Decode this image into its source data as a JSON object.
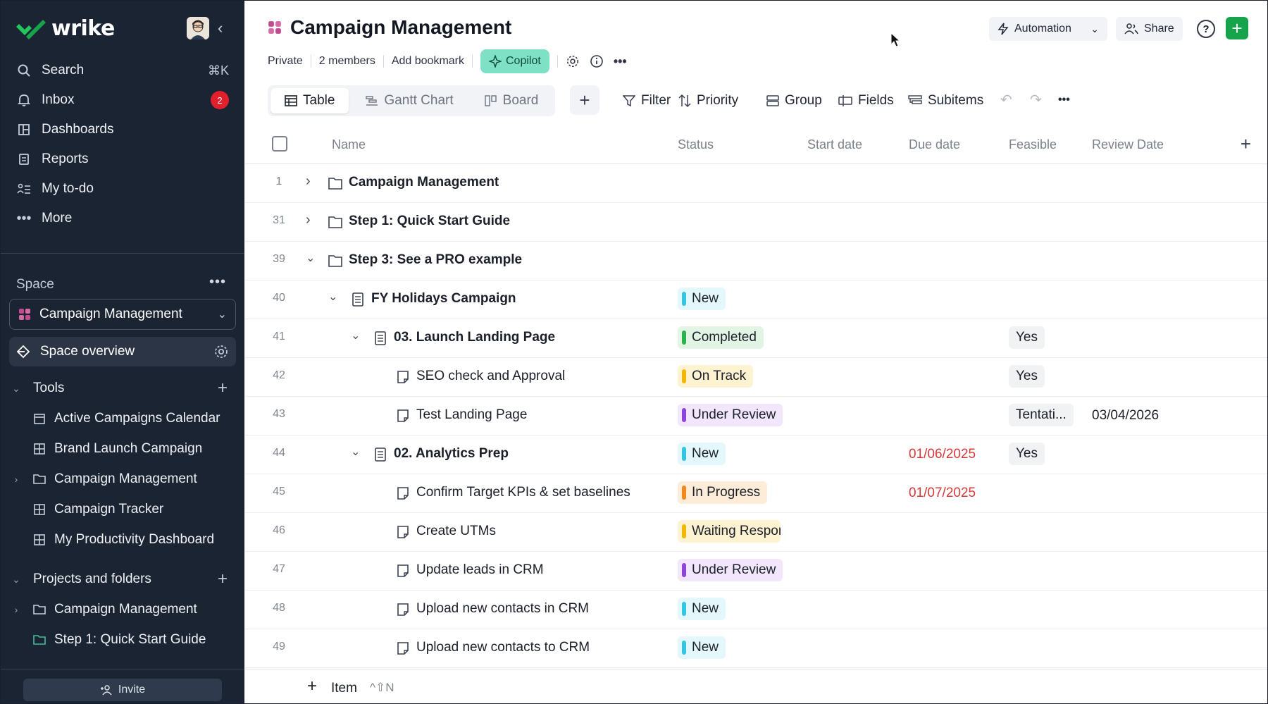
{
  "sidebar": {
    "logo": "wrike",
    "nav": [
      {
        "label": "Search",
        "icon": "search-icon",
        "shortcut": "⌘K"
      },
      {
        "label": "Inbox",
        "icon": "bell-icon",
        "badge": "2"
      },
      {
        "label": "Dashboards",
        "icon": "dashboard-icon"
      },
      {
        "label": "Reports",
        "icon": "report-icon"
      },
      {
        "label": "My to-do",
        "icon": "todo-icon"
      },
      {
        "label": "More",
        "icon": "more-icon"
      }
    ],
    "space_label": "Space",
    "space_selected": "Campaign Management",
    "space_overview": "Space overview",
    "tools_label": "Tools",
    "tools": [
      {
        "label": "Active Campaigns Calendar",
        "icon": "calendar-icon"
      },
      {
        "label": "Brand Launch Campaign",
        "icon": "grid-icon"
      },
      {
        "label": "Campaign Management",
        "icon": "folder-icon"
      },
      {
        "label": "Campaign Tracker",
        "icon": "grid-icon"
      },
      {
        "label": "My Productivity Dashboard",
        "icon": "grid-icon"
      }
    ],
    "projects_label": "Projects and folders",
    "projects": [
      {
        "label": "Campaign Management",
        "icon": "folder-icon"
      },
      {
        "label": "Step 1: Quick Start Guide",
        "icon": "folder-icon"
      }
    ],
    "invite": "Invite"
  },
  "header": {
    "title": "Campaign Management",
    "privacy": "Private",
    "members": "2 members",
    "bookmark": "Add bookmark",
    "copilot": "Copilot",
    "automation": "Automation",
    "share": "Share",
    "help": "?"
  },
  "views": {
    "table": "Table",
    "gantt": "Gantt Chart",
    "board": "Board"
  },
  "toolbar": {
    "filter": "Filter",
    "priority": "Priority",
    "group": "Group",
    "fields": "Fields",
    "subitems": "Subitems"
  },
  "columns": {
    "name": "Name",
    "status": "Status",
    "start": "Start date",
    "due": "Due date",
    "feasible": "Feasible",
    "review": "Review Date"
  },
  "rows": [
    {
      "num": "1",
      "name": "Campaign Management",
      "type": "folder",
      "bold": true
    },
    {
      "num": "31",
      "name": "Step 1: Quick Start Guide",
      "type": "folder",
      "bold": true
    },
    {
      "num": "39",
      "name": "Step 3: See a PRO example",
      "type": "folder",
      "bold": true
    },
    {
      "num": "40",
      "name": "FY Holidays Campaign",
      "type": "project",
      "bold": true,
      "status": "New"
    },
    {
      "num": "41",
      "name": "03. Launch Landing Page",
      "type": "project",
      "bold": true,
      "status": "Completed",
      "feasible": "Yes"
    },
    {
      "num": "42",
      "name": "SEO check and Approval",
      "type": "task",
      "bold": false,
      "status": "On Track",
      "feasible": "Yes"
    },
    {
      "num": "43",
      "name": "Test Landing Page",
      "type": "task",
      "bold": false,
      "status": "Under Review",
      "feasible": "Tentati...",
      "review": "03/04/2026"
    },
    {
      "num": "44",
      "name": "02. Analytics Prep",
      "type": "project",
      "bold": true,
      "status": "New",
      "due": "01/06/2025",
      "feasible": "Yes"
    },
    {
      "num": "45",
      "name": "Confirm Target KPIs & set baselines",
      "type": "task",
      "bold": false,
      "status": "In Progress",
      "due": "01/07/2025"
    },
    {
      "num": "46",
      "name": "Create UTMs",
      "type": "task",
      "bold": false,
      "status": "Waiting Respons"
    },
    {
      "num": "47",
      "name": "Update leads in CRM",
      "type": "task",
      "bold": false,
      "status": "Under Review"
    },
    {
      "num": "48",
      "name": "Upload new contacts in CRM",
      "type": "task",
      "bold": false,
      "status": "New"
    },
    {
      "num": "49",
      "name": "Upload new contacts to CRM",
      "type": "task",
      "bold": false,
      "status": "New"
    }
  ],
  "status_colors": {
    "New": {
      "bar": "#36c5e0",
      "bg": "#e4f8fb"
    },
    "Completed": {
      "bar": "#2bb24c",
      "bg": "#e2f5e5"
    },
    "On Track": {
      "bar": "#f2b705",
      "bg": "#fdf3d1"
    },
    "Under Review": {
      "bar": "#8e44d8",
      "bg": "#f1e6fb"
    },
    "In Progress": {
      "bar": "#f08a1c",
      "bg": "#fdecd8"
    },
    "Waiting Respons": {
      "bar": "#f2b705",
      "bg": "#fdf3d1"
    }
  },
  "footer": {
    "add_item": "Item",
    "shortcut": "^⇧N"
  }
}
